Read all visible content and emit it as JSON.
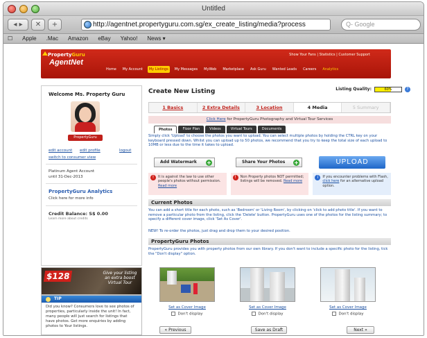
{
  "window": {
    "title": "Untitled"
  },
  "browser": {
    "url": "http://agentnet.propertyguru.com.sg/ex_create_listing/media?process",
    "search_placeholder": "Q- Google",
    "back": "◂ ▸",
    "stop": "✕",
    "add": "+"
  },
  "bookmarks": [
    "Apple",
    ".Mac",
    "Amazon",
    "eBay",
    "Yahoo!",
    "News ▾"
  ],
  "header": {
    "brand_top": "Property",
    "brand_top2": "Guru",
    "brand_main": "AgentNet",
    "top_links": "Show Your Fans  |  Statistics  |  Customer Support",
    "nav": [
      "Home",
      "My Account",
      "My Listings",
      "My Messages",
      "MyWeb",
      "Marketplace",
      "Ask Guru",
      "Wanted Leads",
      "Careers",
      "Analytics"
    ]
  },
  "sidebar": {
    "welcome": "Welcome Ms. Property Guru",
    "badge": "PropertyGuru",
    "edit_account": "edit account",
    "edit_profile": "edit profile",
    "logout": "logout",
    "switch": "switch to consumer view",
    "plan": "Platinum Agent Account",
    "until": "until 31-Dec-2013",
    "analytics_title": "PropertyGuru Analytics",
    "analytics_text": "Click here for more info",
    "credit": "Credit Balance: S$ 0.00",
    "credit_sub": "Learn more about credits"
  },
  "promo": {
    "price": "$128",
    "text": "Give your listing an extra boost Virtual Tour"
  },
  "tip": {
    "title": "TIP",
    "body": "Did you know? Consumers love to see photos of properties, particularly inside the unit! In fact, many people will just search for listings that have photos. Get more enquiries by adding photos to Your listings."
  },
  "main": {
    "title": "Create New Listing",
    "quality_label": "Listing Quality:",
    "quality_value": "60%",
    "quality_fraction": 0.6,
    "steps": [
      "1 Basics",
      "2 Extra Details",
      "3 Location",
      "4 Media",
      "5 Summary"
    ],
    "photo_bar_link": "Click Here",
    "photo_bar_text": " for PropertyGuru Photography and Virtual Tour Services",
    "subtabs": [
      "Photos",
      "Floor Plan",
      "Videos",
      "Virtual Tours",
      "Documents"
    ],
    "intro": "Simply click 'Upload' to choose the photos you want to upload. You can select multiple photos by holding the CTRL key on your keyboard pressed down. Whilst you can upload up to 50 photos, we recommend that you try to keep the total size of each upload to 10MB or less due to the time it takes to upload.",
    "add_watermark": "Add Watermark",
    "share_photos": "Share Your Photos",
    "upload": "UPLOAD",
    "warn1": "It is against the law to use other people's photos without permission.",
    "warn1_link": "Read more",
    "warn2": "Non Property photos NOT permitted; listings will be removed.",
    "warn2_link": "Read more",
    "warn3": "If you encounter problems with Flash,",
    "warn3_link": "click here",
    "warn3b": " for an alternative upload option.",
    "current_head": "Current Photos",
    "current_text": "You can add a short title for each photo, such as 'Bedroom' or 'Living Room', by clicking on 'click to add photo title'. If you want to remove a particular photo from the listing, click the 'Delete' button. PropertyGuru uses one of the photos for the listing summary; to specify a different cover image, click 'Set As Cover'.",
    "reorder_text": "NEW! To re-order the photos, just drag and drop them to your desired position.",
    "pg_head": "PropertyGuru Photos",
    "pg_text": "PropertyGuru provides you with property photos from our own library. If you don't want to include a specific photo for the listing, tick the \"Don't display\" option.",
    "photo_cards": [
      {
        "set": "Set as Cover Image",
        "dd": "Don't display"
      },
      {
        "set": "Set as Cover Image",
        "dd": "Don't display"
      },
      {
        "set": "Set as Cover Image",
        "dd": "Don't display"
      }
    ],
    "prev": "« Previous",
    "save": "Save as Draft",
    "next": "Next »"
  }
}
